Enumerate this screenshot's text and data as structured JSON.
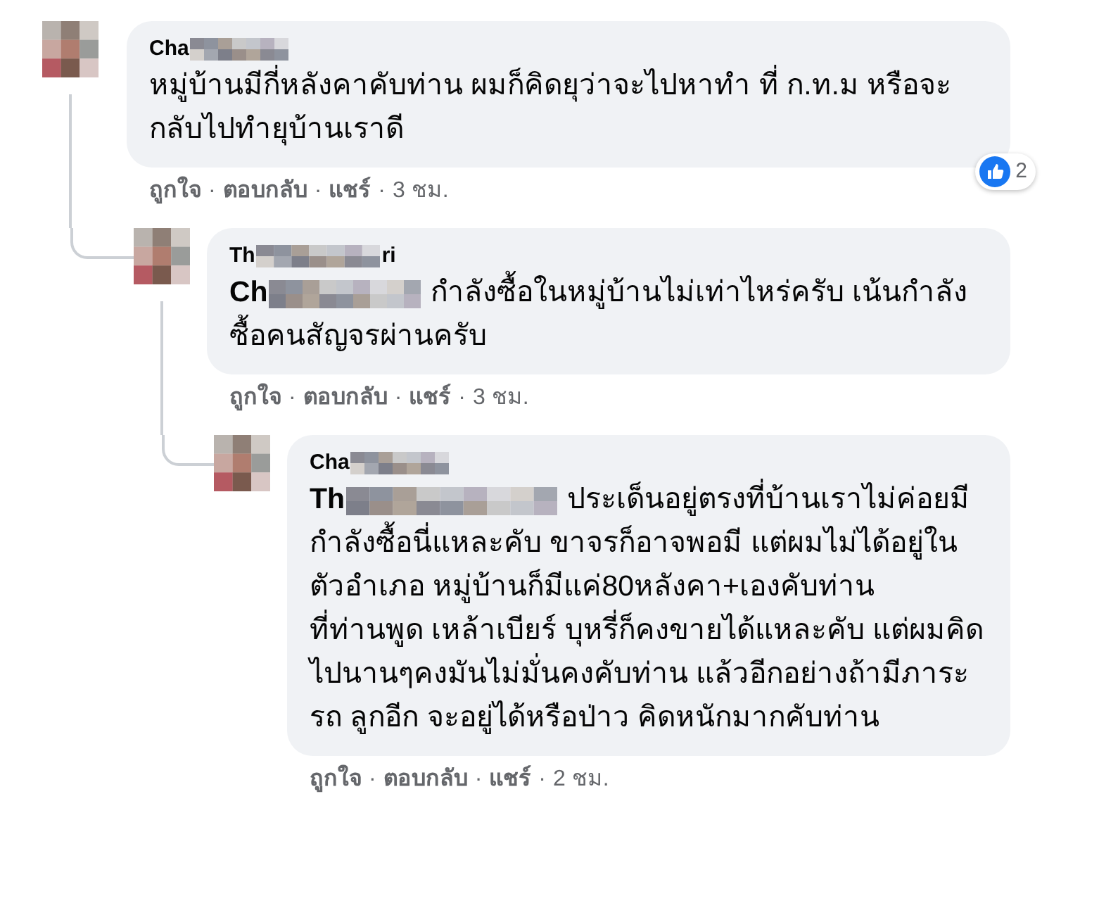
{
  "comments": [
    {
      "author_start": "Cha",
      "text": "หมู่บ้านมีกี่หลังคาคับท่าน ผมก็คิดยุว่าจะไปหาทำ ที่ ก.ท.ม หรือจะกลับไปทำยุบ้านเราดี",
      "footer": [
        {
          "kind": "link",
          "text": "ถูกใจ"
        },
        {
          "kind": "dot",
          "text": "·"
        },
        {
          "kind": "link",
          "text": "ตอบกลับ"
        },
        {
          "kind": "dot",
          "text": "·"
        },
        {
          "kind": "link",
          "text": "แชร์"
        },
        {
          "kind": "dot",
          "text": "·"
        },
        {
          "kind": "time",
          "text": "3 ชม."
        }
      ],
      "reactions": {
        "count": "2"
      },
      "children": [
        {
          "author_start": "Th",
          "author_end": "ri",
          "mention_start": "Ch",
          "text": "กำลังซื้อในหมู่บ้านไม่เท่าไหร่ครับ เน้นกำลังซื้อคนสัญจรผ่านครับ",
          "footer": [
            {
              "kind": "link",
              "text": "ถูกใจ"
            },
            {
              "kind": "dot",
              "text": "·"
            },
            {
              "kind": "link",
              "text": "ตอบกลับ"
            },
            {
              "kind": "dot",
              "text": "·"
            },
            {
              "kind": "link",
              "text": "แชร์"
            },
            {
              "kind": "dot",
              "text": "·"
            },
            {
              "kind": "time",
              "text": "3 ชม."
            }
          ],
          "children": [
            {
              "author_start": "Cha",
              "mention_start": "Th",
              "text": "ประเด็นอยู่ตรงที่บ้านเราไม่ค่อยมีกำลังซื้อนี่แหละคับ ขาจรก็อาจพอมี แต่ผมไม่ได้อยู่ในตัวอำเภอ หมู่บ้านก็มีแค่80หลังคา+เองคับท่าน\nที่ท่านพูด เหล้าเบียร์ บุหรี่ก็คงขายได้แหละคับ แต่ผมคิดไปนานๆคงมันไม่มั่นคงคับท่าน แล้วอีกอย่างถ้ามีภาระ รถ ลูกอีก จะอยู่ได้หรือป่าว คิดหนักมากคับท่าน",
              "footer": [
                {
                  "kind": "link",
                  "text": "ถูกใจ"
                },
                {
                  "kind": "dot",
                  "text": "·"
                },
                {
                  "kind": "link",
                  "text": "ตอบกลับ"
                },
                {
                  "kind": "dot",
                  "text": "·"
                },
                {
                  "kind": "link",
                  "text": "แชร์"
                },
                {
                  "kind": "dot",
                  "text": "·"
                },
                {
                  "kind": "time",
                  "text": "2 ชม."
                }
              ]
            }
          ]
        }
      ]
    }
  ]
}
